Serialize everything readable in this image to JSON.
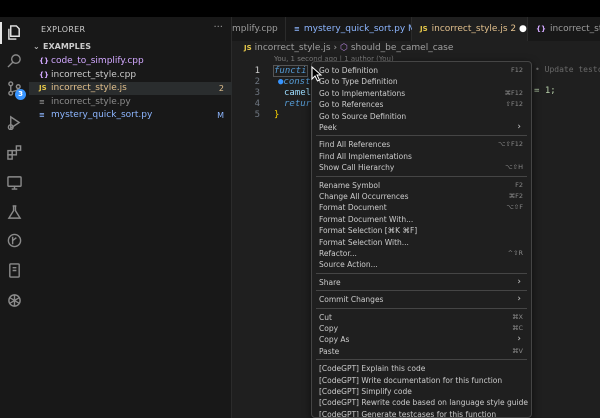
{
  "activity_bar": {
    "badges": {
      "source_control": "3"
    }
  },
  "sidebar": {
    "title": "EXPLORER",
    "more": "···",
    "folder": "EXAMPLES",
    "files": [
      {
        "icon": "{}",
        "name": "code_to_simplify.cpp",
        "status": "",
        "color": "#d2a8ff",
        "icon_color": "#d2a8ff"
      },
      {
        "icon": "{}",
        "name": "incorrect_style.cpp",
        "status": "",
        "color": "#cccccc",
        "icon_color": "#d2a8ff"
      },
      {
        "icon": "JS",
        "name": "incorrect_style.js",
        "status": "2",
        "color": "#e2c08d",
        "icon_color": "#e6c84a"
      },
      {
        "icon": "≡",
        "name": "incorrect_style.py",
        "status": "",
        "color": "#8b8b8b",
        "icon_color": "#8b8b8b"
      },
      {
        "icon": "≡",
        "name": "mystery_quick_sort.py",
        "status": "M",
        "color": "#8db6ff",
        "icon_color": "#8db6ff"
      }
    ]
  },
  "tabs": [
    {
      "icon": "",
      "label": "mplify.cpp",
      "suffix": "",
      "active": false
    },
    {
      "icon": "≡",
      "label": "mystery_quick_sort.py",
      "suffix": "M",
      "dot": true,
      "active": false
    },
    {
      "icon": "JS",
      "label": "incorrect_style.js",
      "suffix": "2",
      "dot": true,
      "active": true
    },
    {
      "icon": "{}",
      "label": "incorrect_sty",
      "suffix": "",
      "active": false
    }
  ],
  "editor": {
    "breadcrumb": {
      "file": "incorrect_style.js",
      "symbol": "should_be_camel_case"
    },
    "blame": "You, 1 second ago | 1 author (You)",
    "line_numbers": [
      "1",
      "2",
      "3",
      "4",
      "5"
    ],
    "ghost_text": "• Update testc",
    "tail_text": "= 1;"
  },
  "context_menu": {
    "groups": [
      [
        {
          "label": "Go to Definition",
          "shortcut": "F12"
        },
        {
          "label": "Go to Type Definition",
          "shortcut": ""
        },
        {
          "label": "Go to Implementations",
          "shortcut": "⌘F12"
        },
        {
          "label": "Go to References",
          "shortcut": "⇧F12"
        },
        {
          "label": "Go to Source Definition",
          "shortcut": ""
        },
        {
          "label": "Peek",
          "shortcut": "",
          "submenu": true
        }
      ],
      [
        {
          "label": "Find All References",
          "shortcut": "⌥⇧F12"
        },
        {
          "label": "Find All Implementations",
          "shortcut": ""
        },
        {
          "label": "Show Call Hierarchy",
          "shortcut": "⌥⇧H"
        }
      ],
      [
        {
          "label": "Rename Symbol",
          "shortcut": "F2"
        },
        {
          "label": "Change All Occurrences",
          "shortcut": "⌘F2"
        },
        {
          "label": "Format Document",
          "shortcut": "⌥⇧F"
        },
        {
          "label": "Format Document With...",
          "shortcut": ""
        },
        {
          "label": "Format Selection [⌘K ⌘F]",
          "shortcut": ""
        },
        {
          "label": "Format Selection With...",
          "shortcut": ""
        },
        {
          "label": "Refactor...",
          "shortcut": "^⇧R"
        },
        {
          "label": "Source Action...",
          "shortcut": ""
        }
      ],
      [
        {
          "label": "Share",
          "shortcut": "",
          "submenu": true
        }
      ],
      [
        {
          "label": "Commit Changes",
          "shortcut": "",
          "submenu": true
        }
      ],
      [
        {
          "label": "Cut",
          "shortcut": "⌘X"
        },
        {
          "label": "Copy",
          "shortcut": "⌘C"
        },
        {
          "label": "Copy As",
          "shortcut": "",
          "submenu": true
        },
        {
          "label": "Paste",
          "shortcut": "⌘V"
        }
      ],
      [
        {
          "label": "[CodeGPT] Explain this code",
          "shortcut": ""
        },
        {
          "label": "[CodeGPT] Write documentation for this function",
          "shortcut": ""
        },
        {
          "label": "[CodeGPT] Simplify code",
          "shortcut": ""
        },
        {
          "label": "[CodeGPT] Rewrite code based on language style guide",
          "shortcut": ""
        },
        {
          "label": "[CodeGPT] Generate testcases for this function",
          "shortcut": ""
        }
      ]
    ]
  }
}
